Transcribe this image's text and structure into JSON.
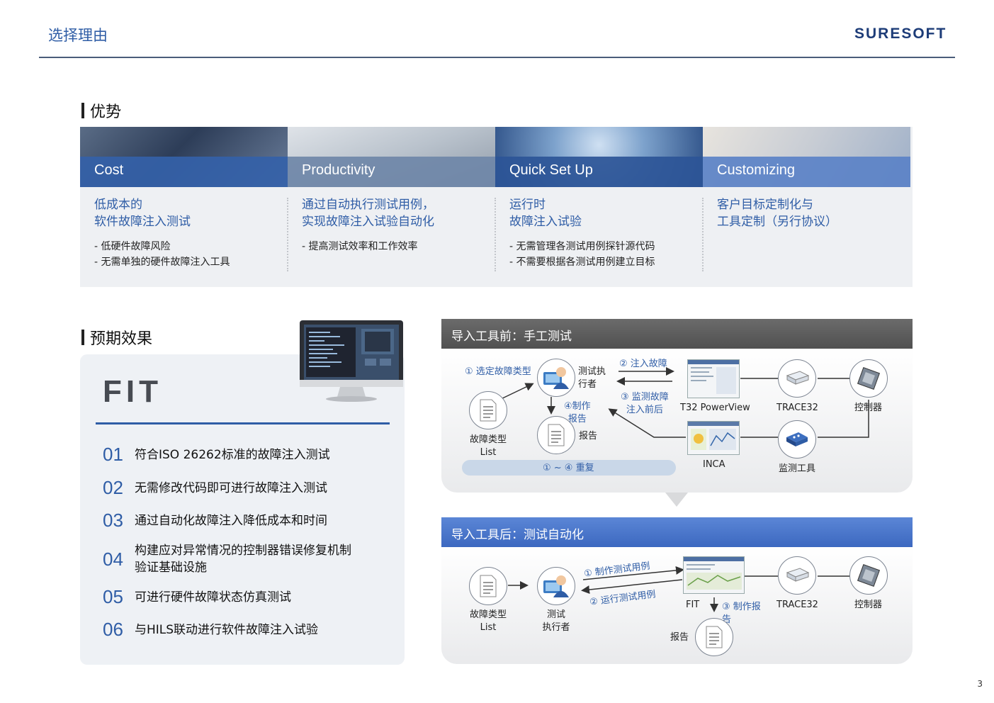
{
  "header": {
    "title": "选择理由",
    "logo": "SURESOFT"
  },
  "advantages": {
    "title": "优势",
    "columns": [
      {
        "label": "Cost",
        "main": [
          "低成本的",
          "软件故障注入测试"
        ],
        "bullets": [
          "-  低硬件故障风险",
          "-  无需单独的硬件故障注入工具"
        ]
      },
      {
        "label": "Productivity",
        "main": [
          "通过自动执行测试用例，",
          "实现故障注入试验自动化"
        ],
        "bullets": [
          "-  提高测试效率和工作效率"
        ]
      },
      {
        "label": "Quick Set Up",
        "main": [
          "运行时",
          "故障注入试验"
        ],
        "bullets": [
          "-  无需管理各测试用例探针源代码",
          "-  不需要根据各测试用例建立目标"
        ]
      },
      {
        "label": "Customizing",
        "main": [
          "客户目标定制化与",
          "工具定制（另行协议）"
        ],
        "bullets": []
      }
    ]
  },
  "expected": {
    "title": "预期效果",
    "fit": "FIT",
    "items": [
      {
        "num": "01",
        "lines": [
          "符合ISO 26262标准的故障注入测试"
        ]
      },
      {
        "num": "02",
        "lines": [
          "无需修改代码即可进行故障注入测试"
        ]
      },
      {
        "num": "03",
        "lines": [
          "通过自动化故障注入降低成本和时间"
        ]
      },
      {
        "num": "04",
        "lines": [
          "构建应对异常情况的控制器错误修复机制",
          "验证基础设施"
        ]
      },
      {
        "num": "05",
        "lines": [
          "可进行硬件故障状态仿真测试"
        ]
      },
      {
        "num": "06",
        "lines": [
          "与HILS联动进行软件故障注入试验"
        ]
      }
    ]
  },
  "before": {
    "title": "导入工具前：手工测试",
    "step1": "① 选定故障类型",
    "tester": [
      "测试执",
      "行者"
    ],
    "step2": "② 注入故障",
    "step3": [
      "③ 监测故障",
      "注入前后"
    ],
    "step4": [
      "④制作",
      "报告"
    ],
    "report": "报告",
    "faultlist": [
      "故障类型",
      "List"
    ],
    "repeat": "① ~ ④ 重复",
    "t32": "T32 PowerView",
    "trace32": "TRACE32",
    "controller": "控制器",
    "inca": "INCA",
    "monitor": "监测工具"
  },
  "after": {
    "title": "导入工具后：测试自动化",
    "faultlist": [
      "故障类型",
      "List"
    ],
    "tester": [
      "测试",
      "执行者"
    ],
    "step1": "① 制作测试用例",
    "step2": "② 运行测试用例",
    "fit": "FIT",
    "step3": [
      "③ 制作报",
      "告"
    ],
    "trace32": "TRACE32",
    "controller": "控制器",
    "report": "报告"
  },
  "page_number": "3",
  "colors": {
    "accent": "#2f5da6",
    "dark_header": "#5c5c5c",
    "blue_header": "#4472c4"
  }
}
